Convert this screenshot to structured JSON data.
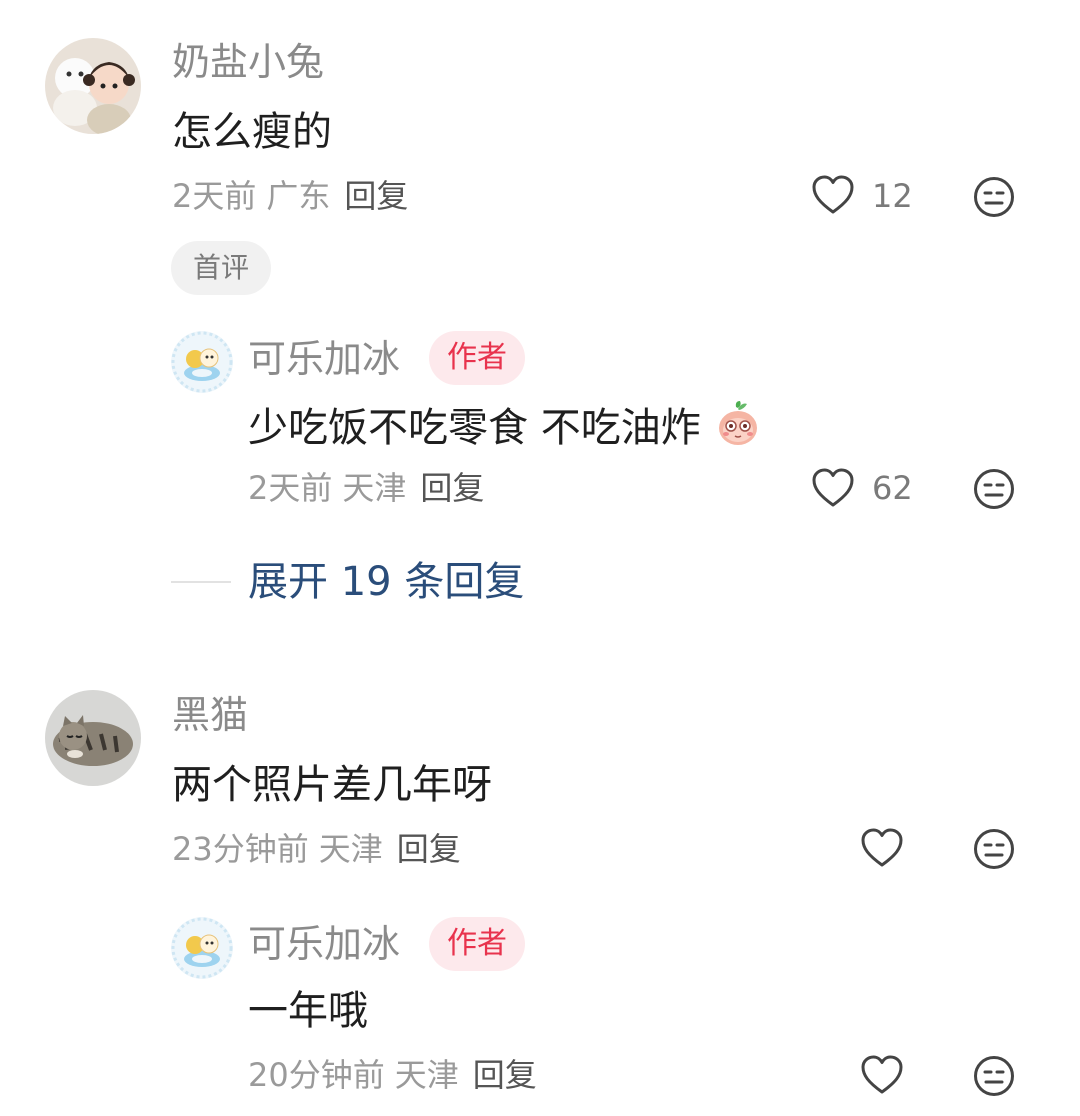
{
  "comments": [
    {
      "user": "奶盐小兔",
      "text": "怎么瘦的",
      "time": "2天前",
      "region": "广东",
      "reply_label": "回复",
      "likes": "12",
      "badge": "首评",
      "replies": [
        {
          "user": "可乐加冰",
          "author_badge": "作者",
          "text": "少吃饭不吃零食 不吃油炸",
          "time": "2天前",
          "region": "天津",
          "reply_label": "回复",
          "likes": "62"
        }
      ],
      "expand_label": "展开 19 条回复"
    },
    {
      "user": "黑猫",
      "text": "两个照片差几年呀",
      "time": "23分钟前",
      "region": "天津",
      "reply_label": "回复",
      "likes": "",
      "replies": [
        {
          "user": "可乐加冰",
          "author_badge": "作者",
          "text": "一年哦",
          "time": "20分钟前",
          "region": "天津",
          "reply_label": "回复",
          "likes": ""
        }
      ]
    }
  ],
  "icons": {
    "like": "heart-outline-icon",
    "dislike": "meh-face-icon",
    "emoji": "peach-shy-emoji-icon"
  },
  "colors": {
    "author_badge_bg": "#fde9ec",
    "author_badge_text": "#e8334d",
    "expand_link": "#2a4d7a"
  }
}
